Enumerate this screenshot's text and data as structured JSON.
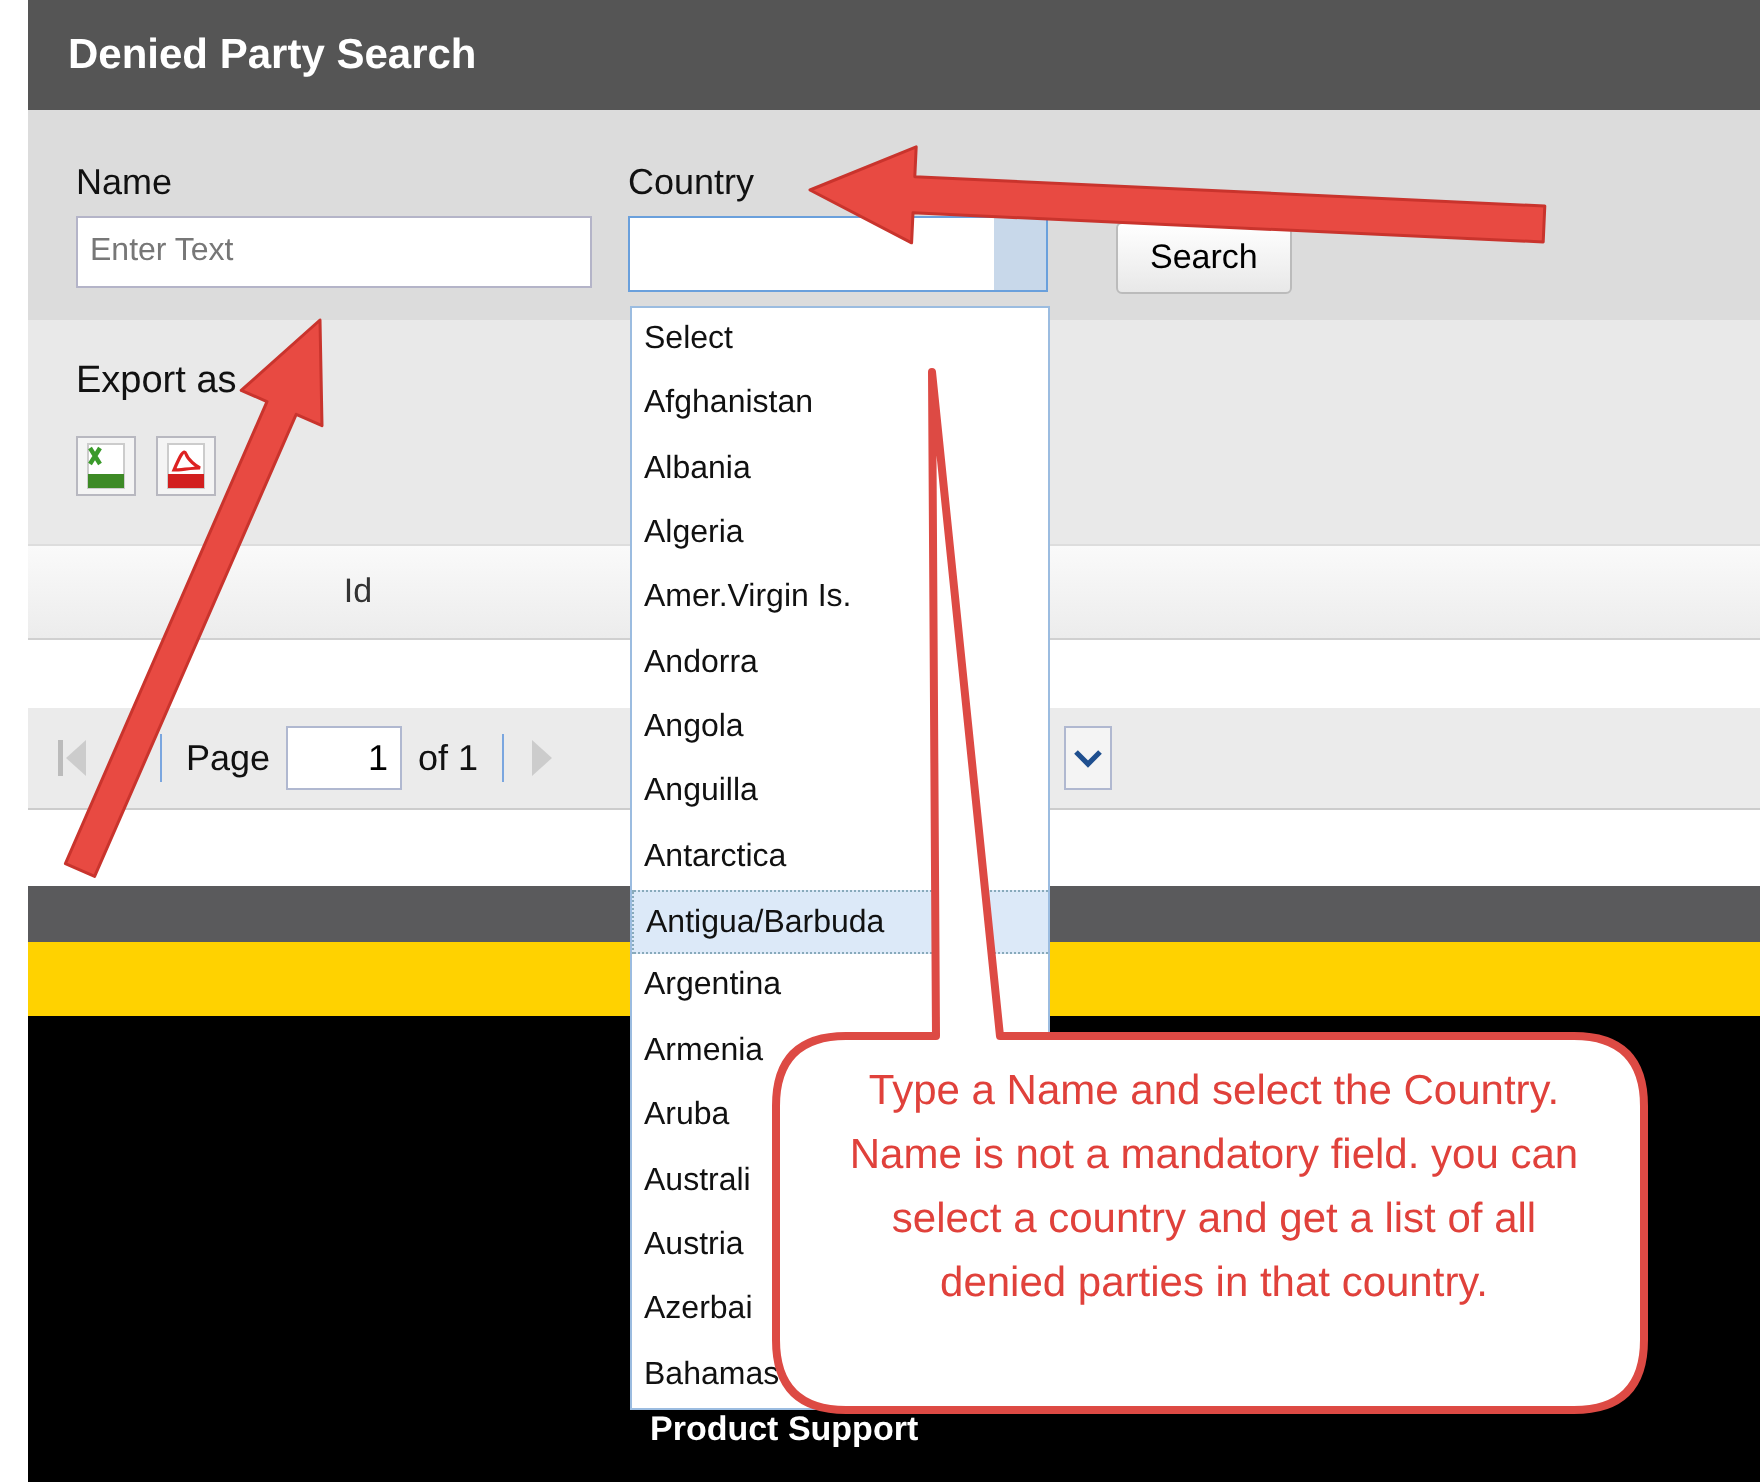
{
  "header": {
    "title": "Denied Party Search"
  },
  "form": {
    "name_label": "Name",
    "name_field": {
      "placeholder": "Enter Text"
    },
    "country_label": "Country",
    "country_select": {
      "expanded": true
    },
    "search_button": "Search"
  },
  "export": {
    "label": "Export as"
  },
  "grid": {
    "columns": [
      "Id"
    ]
  },
  "pager": {
    "page_label": "Page",
    "page_value": "1",
    "of_label": "of 1"
  },
  "country_list": [
    {
      "label": "Select",
      "selected": false
    },
    {
      "label": "Afghanistan",
      "selected": false
    },
    {
      "label": "Albania",
      "selected": false
    },
    {
      "label": "Algeria",
      "selected": false
    },
    {
      "label": "Amer.Virgin Is.",
      "selected": false
    },
    {
      "label": "Andorra",
      "selected": false
    },
    {
      "label": "Angola",
      "selected": false
    },
    {
      "label": "Anguilla",
      "selected": false
    },
    {
      "label": "Antarctica",
      "selected": false
    },
    {
      "label": "Antigua/Barbuda",
      "selected": true
    },
    {
      "label": "Argentina",
      "selected": false
    },
    {
      "label": "Armenia",
      "selected": false
    },
    {
      "label": "Aruba",
      "selected": false
    },
    {
      "label": "Australi",
      "selected": false
    },
    {
      "label": "Austria",
      "selected": false
    },
    {
      "label": "Azerbai",
      "selected": false
    },
    {
      "label": "Bahamas",
      "selected": false
    }
  ],
  "footer": {
    "text": "Product Support"
  },
  "callout": {
    "text": "Type a Name and select the Country. Name is not a mandatory field. you can select a country and get a list of all denied parties in that country."
  }
}
